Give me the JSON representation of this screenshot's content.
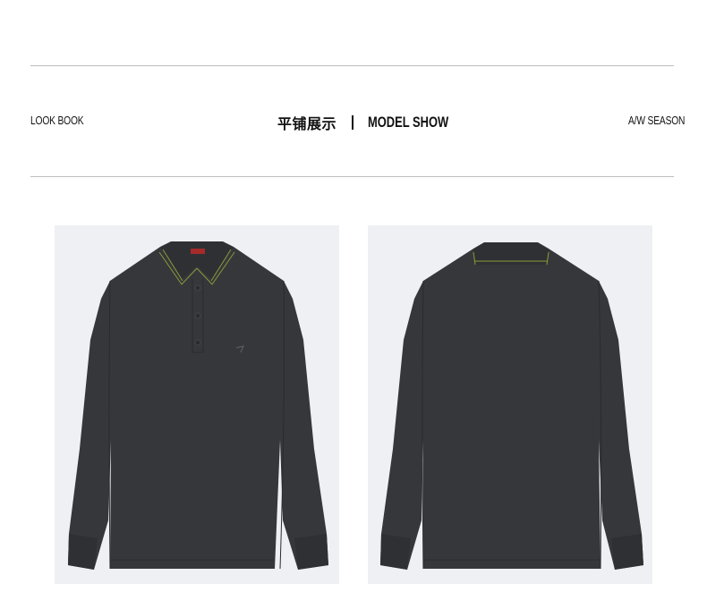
{
  "header": {
    "left_label": "LOOK BOOK",
    "title_cn": "平铺展示",
    "title_en": "MODEL SHOW",
    "right_label": "A/W SEASON"
  },
  "products": [
    {
      "view": "front",
      "icon": "polo-shirt-front-icon"
    },
    {
      "view": "back",
      "icon": "polo-shirt-back-icon"
    }
  ],
  "colors": {
    "shirt": "#36373b",
    "panel_bg": "#eef0f3",
    "collar_stripe": "#8a9a3a",
    "label_red": "#a52a2a"
  }
}
